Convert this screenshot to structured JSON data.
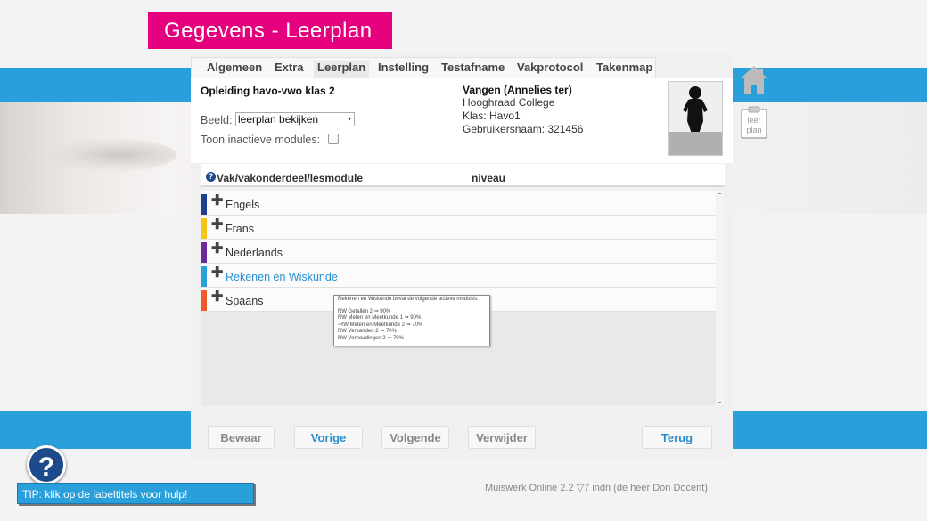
{
  "header": {
    "title": "Gegevens - Leerplan"
  },
  "tabs": [
    {
      "label": "Algemeen"
    },
    {
      "label": "Extra"
    },
    {
      "label": "Leerplan",
      "active": true
    },
    {
      "label": "Instelling"
    },
    {
      "label": "Testafname"
    },
    {
      "label": "Vakprotocol"
    },
    {
      "label": "Takenmap"
    }
  ],
  "info": {
    "opleiding": "Opleiding havo-vwo klas 2",
    "beeld_label": "Beeld:",
    "beeld_value": "leerplan bekijken",
    "toon_label": "Toon inactieve modules:",
    "toon_checked": false
  },
  "student": {
    "name": "Vangen (Annelies ter)",
    "school": "Hooghraad College",
    "klas": "Klas: Havo1",
    "gebruikersnaam": "Gebruikersnaam: 321456"
  },
  "list": {
    "col_subject": "Vak/vakonderdeel/lesmodule",
    "col_level": "niveau",
    "rows": [
      {
        "name": "Engels",
        "color": "#1f3f8f",
        "plus": "✚"
      },
      {
        "name": "Frans",
        "color": "#f5c518",
        "plus": "✚"
      },
      {
        "name": "Nederlands",
        "color": "#6a2a9a",
        "plus": "✚"
      },
      {
        "name": "Rekenen en Wiskunde",
        "color": "#29a0dc",
        "plus": "✚",
        "highlight": true
      },
      {
        "name": "Spaans",
        "color": "#f05a28",
        "plus": "✚"
      }
    ]
  },
  "tooltip": {
    "title": "Rekenen en Wiskunde bevat de volgende actieve modules:",
    "lines": [
      "RW Getallen 2 ⇒ 90%",
      "RW Meten en Meetkunde 1 ⇒ 90%",
      "-RW Meten en Meetkunde 2 ⇒ 70%",
      "RW Verbanden 2 ⇒ 70%",
      "RW Verhoudingen 2 ⇒ 70%"
    ]
  },
  "buttons": {
    "bewaar": "Bewaar",
    "vorige": "Vorige",
    "volgende": "Volgende",
    "verwijder": "Verwijder",
    "terug": "Terug"
  },
  "footer": {
    "text": "Muiswerk Online 2.2  ▽7  indri  (de heer Don Docent)"
  },
  "side": {
    "leerplan_icon_text_1": "leer",
    "leerplan_icon_text_2": "plan"
  },
  "help": {
    "glyph": "?",
    "tip": "TIP: klik op de labeltitels voor hulp!"
  },
  "colors": {
    "accent_pink": "#e5007e",
    "accent_blue": "#29a0dc",
    "link_blue": "#2a8dcf"
  }
}
